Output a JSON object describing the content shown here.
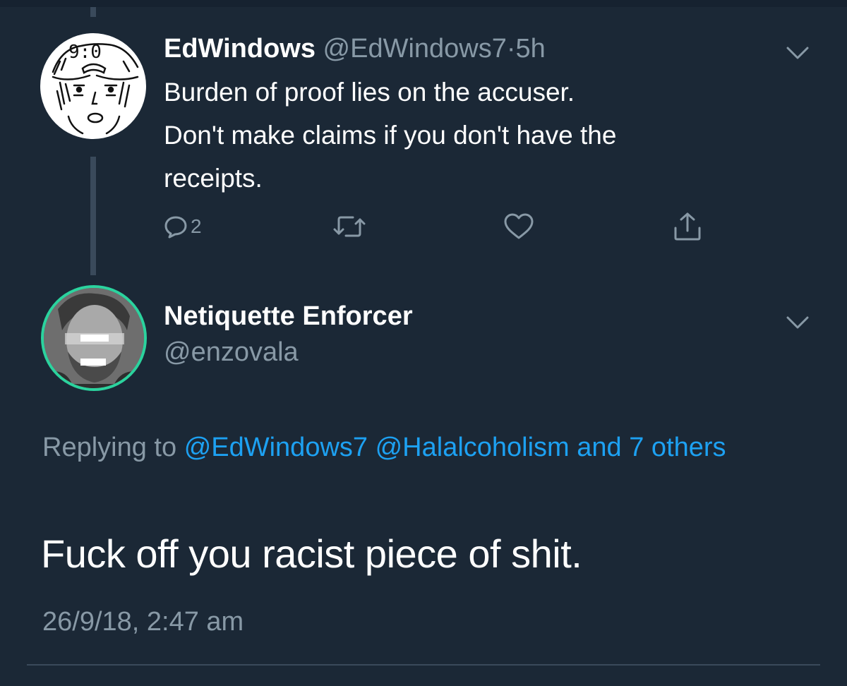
{
  "tweet1": {
    "display_name": "EdWindows",
    "handle": "@EdWindows7",
    "separator": "·",
    "time_ago": "5h",
    "text_lines": [
      "Burden of proof lies on the accuser.",
      "Don't make claims if you don't have the",
      "receipts."
    ],
    "actions": {
      "reply_count": "2",
      "reply_icon": "reply-icon",
      "retweet_icon": "retweet-icon",
      "like_icon": "heart-icon",
      "share_icon": "share-icon"
    }
  },
  "tweet2": {
    "display_name": "Netiquette Enforcer",
    "handle": "@enzovala",
    "replying_prefix": "Replying to",
    "reply_mentions": [
      "@EdWindows7",
      "@Halalcoholism"
    ],
    "reply_others": "and 7 others",
    "text": "Fuck off you racist piece of shit.",
    "timestamp": "26/9/18, 2:47 am"
  },
  "colors": {
    "background": "#1b2836",
    "link": "#1da1f2",
    "secondary_text": "#8899a6",
    "avatar_ring": "#2bd39e"
  }
}
